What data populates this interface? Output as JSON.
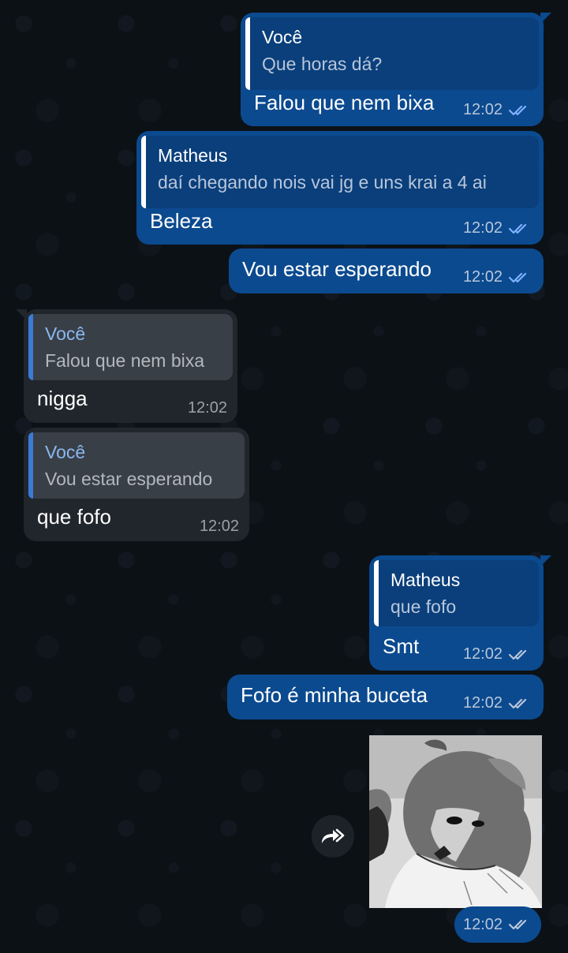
{
  "chat": {
    "messages": [
      {
        "direction": "outgoing",
        "quote_author": "Você",
        "quote_text": "Que horas dá?",
        "text": "Falou que nem bixa",
        "time": "12:02",
        "status": "read"
      },
      {
        "direction": "outgoing",
        "quote_author": "Matheus",
        "quote_text": "daí chegando nois vai jg e uns krai a 4 ai",
        "text": "Beleza",
        "time": "12:02",
        "status": "read"
      },
      {
        "direction": "outgoing",
        "text": "Vou estar esperando",
        "time": "12:02",
        "status": "read"
      },
      {
        "direction": "incoming",
        "quote_author": "Você",
        "quote_text": "Falou que nem bixa",
        "text": "nigga",
        "time": "12:02"
      },
      {
        "direction": "incoming",
        "quote_author": "Você",
        "quote_text": "Vou estar esperando",
        "text": "que fofo",
        "time": "12:02"
      },
      {
        "direction": "outgoing",
        "quote_author": "Matheus",
        "quote_text": "que fofo",
        "text": "Smt",
        "time": "12:02",
        "status": "read"
      },
      {
        "direction": "outgoing",
        "text": "Fofo é minha buceta",
        "time": "12:02",
        "status": "read"
      },
      {
        "direction": "outgoing",
        "type": "image",
        "image_desc": "manga-style grayscale drawing of a fluffy animal character",
        "time": "12:02",
        "status": "read"
      }
    ]
  },
  "colors": {
    "outgoing_bubble": "#0b4a8f",
    "incoming_bubble": "#21262c",
    "background": "#0c1116",
    "read_ticks": "#7fb2ff"
  },
  "icons": {
    "read_status": "double-check-icon",
    "forward": "forward-icon"
  }
}
